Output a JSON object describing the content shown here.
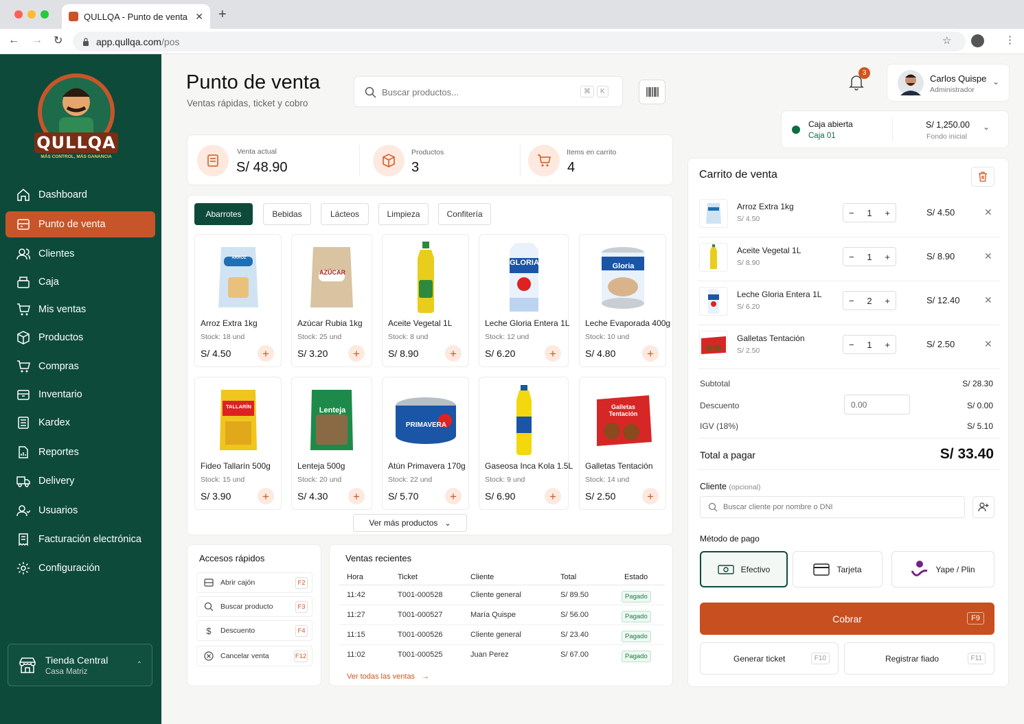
{
  "browser": {
    "tab_title": "QULLQA - Punto de venta",
    "url_host": "app.qullqa.com",
    "url_path": "/pos"
  },
  "brand": {
    "logo_text": "QULLQA",
    "tagline": "MÁS CONTROL, MÁS GANANCIA",
    "primary": "#0d4a3a",
    "accent": "#c8552a"
  },
  "sidebar": {
    "items": [
      {
        "label": "Dashboard",
        "icon": "home-icon"
      },
      {
        "label": "Punto de venta",
        "icon": "pos-icon"
      },
      {
        "label": "Clientes",
        "icon": "users-icon"
      },
      {
        "label": "Caja",
        "icon": "cash-register-icon"
      },
      {
        "label": "Mis ventas",
        "icon": "cart-icon"
      },
      {
        "label": "Productos",
        "icon": "box-icon"
      },
      {
        "label": "Compras",
        "icon": "cart-icon"
      },
      {
        "label": "Inventario",
        "icon": "inventory-icon"
      },
      {
        "label": "Kardex",
        "icon": "list-icon"
      },
      {
        "label": "Reportes",
        "icon": "report-icon"
      },
      {
        "label": "Delivery",
        "icon": "truck-icon"
      },
      {
        "label": "Usuarios",
        "icon": "user-group-icon"
      },
      {
        "label": "Facturación electrónica",
        "icon": "invoice-icon"
      },
      {
        "label": "Configuración",
        "icon": "gear-icon"
      }
    ],
    "store": {
      "name": "Tienda Central",
      "sub": "Casa Matriz"
    }
  },
  "header": {
    "title": "Punto de venta",
    "subtitle": "Ventas rápidas, ticket y cobro",
    "search_placeholder": "Buscar productos...",
    "shortcut_cmd": "⌘",
    "shortcut_key": "K",
    "notifications": "3",
    "user_name": "Carlos Quispe",
    "user_role": "Administrador"
  },
  "cashbox": {
    "status": "Caja abierta",
    "name": "Caja 01",
    "amount": "S/ 1,250.00",
    "amount_label": "Fondo inicial"
  },
  "stats": [
    {
      "label": "Venta actual",
      "value": "S/ 48.90"
    },
    {
      "label": "Productos",
      "value": "3"
    },
    {
      "label": "Items en carrito",
      "value": "4"
    }
  ],
  "categories": [
    "Abarrotes",
    "Bebidas",
    "Lácteos",
    "Limpieza",
    "Confitería"
  ],
  "products": [
    {
      "name": "Arroz Extra 1kg",
      "stock": "Stock: 18 und",
      "price": "S/ 4.50",
      "label": "ARROZ"
    },
    {
      "name": "Azúcar Rubia 1kg",
      "stock": "Stock: 25 und",
      "price": "S/ 3.20",
      "label": "AZÚCAR"
    },
    {
      "name": "Aceite Vegetal 1L",
      "stock": "Stock: 8 und",
      "price": "S/ 8.90",
      "label": ""
    },
    {
      "name": "Leche Gloria Entera 1L",
      "stock": "Stock: 12 und",
      "price": "S/ 6.20",
      "label": "GLORIA"
    },
    {
      "name": "Leche Evaporada 400g",
      "stock": "Stock: 10 und",
      "price": "S/ 4.80",
      "label": "Gloria"
    },
    {
      "name": "Fideo Tallarín 500g",
      "stock": "Stock: 15 und",
      "price": "S/ 3.90",
      "label": "TALLARÍN"
    },
    {
      "name": "Lenteja 500g",
      "stock": "Stock: 20 und",
      "price": "S/ 4.30",
      "label": "Lenteja"
    },
    {
      "name": "Atún Primavera 170g",
      "stock": "Stock: 22 und",
      "price": "S/ 5.70",
      "label": "PRIMAVERA"
    },
    {
      "name": "Gaseosa Inca Kola 1.5L",
      "stock": "Stock: 9 und",
      "price": "S/ 6.90",
      "label": ""
    },
    {
      "name": "Galletas Tentación",
      "stock": "Stock: 14 und",
      "price": "S/ 2.50",
      "label": "Galletas Tentación"
    }
  ],
  "more_products": "Ver más productos",
  "quick_access": {
    "title": "Accesos rápidos",
    "items": [
      {
        "label": "Abrir cajón",
        "key": "F2",
        "icon": "drawer-icon"
      },
      {
        "label": "Buscar producto",
        "key": "F3",
        "icon": "search-icon"
      },
      {
        "label": "Descuento",
        "key": "F4",
        "icon": "dollar-icon"
      },
      {
        "label": "Cancelar venta",
        "key": "F12",
        "icon": "cancel-icon"
      }
    ]
  },
  "recent_sales": {
    "title": "Ventas recientes",
    "headers": [
      "Hora",
      "Ticket",
      "Cliente",
      "Total",
      "Estado"
    ],
    "rows": [
      {
        "hora": "11:42",
        "ticket": "T001-000528",
        "cliente": "Cliente general",
        "total": "S/ 89.50",
        "estado": "Pagado"
      },
      {
        "hora": "11:27",
        "ticket": "T001-000527",
        "cliente": "María Quispe",
        "total": "S/ 56.00",
        "estado": "Pagado"
      },
      {
        "hora": "11:15",
        "ticket": "T001-000526",
        "cliente": "Cliente general",
        "total": "S/ 23.40",
        "estado": "Pagado"
      },
      {
        "hora": "11:02",
        "ticket": "T001-000525",
        "cliente": "Juan Perez",
        "total": "S/ 67.00",
        "estado": "Pagado"
      }
    ],
    "view_all": "Ver todas las ventas"
  },
  "cart": {
    "title": "Carrito de venta",
    "items": [
      {
        "name": "Arroz Extra 1kg",
        "unit": "S/ 4.50",
        "qty": "1",
        "total": "S/ 4.50"
      },
      {
        "name": "Aceite Vegetal 1L",
        "unit": "S/ 8.90",
        "qty": "1",
        "total": "S/ 8.90"
      },
      {
        "name": "Leche Gloria Entera 1L",
        "unit": "S/ 6.20",
        "qty": "2",
        "total": "S/ 12.40"
      },
      {
        "name": "Galletas Tentación",
        "unit": "S/ 2.50",
        "qty": "1",
        "total": "S/ 2.50"
      }
    ],
    "subtotal_label": "Subtotal",
    "subtotal": "S/ 28.30",
    "discount_label": "Descuento",
    "discount_input": "0.00",
    "discount": "S/ 0.00",
    "igv_label": "IGV (18%)",
    "igv": "S/ 5.10",
    "total_label": "Total a pagar",
    "total": "S/ 33.40",
    "client_label": "Cliente",
    "client_optional": "(opcional)",
    "client_placeholder": "Buscar cliente por nombre o DNI",
    "payment_label": "Método de pago",
    "payment_methods": [
      "Efectivo",
      "Tarjeta",
      "Yape / Plin"
    ],
    "charge_label": "Cobrar",
    "charge_key": "F9",
    "ticket_label": "Generar ticket",
    "ticket_key": "F10",
    "credit_label": "Registrar fiado",
    "credit_key": "F11"
  }
}
